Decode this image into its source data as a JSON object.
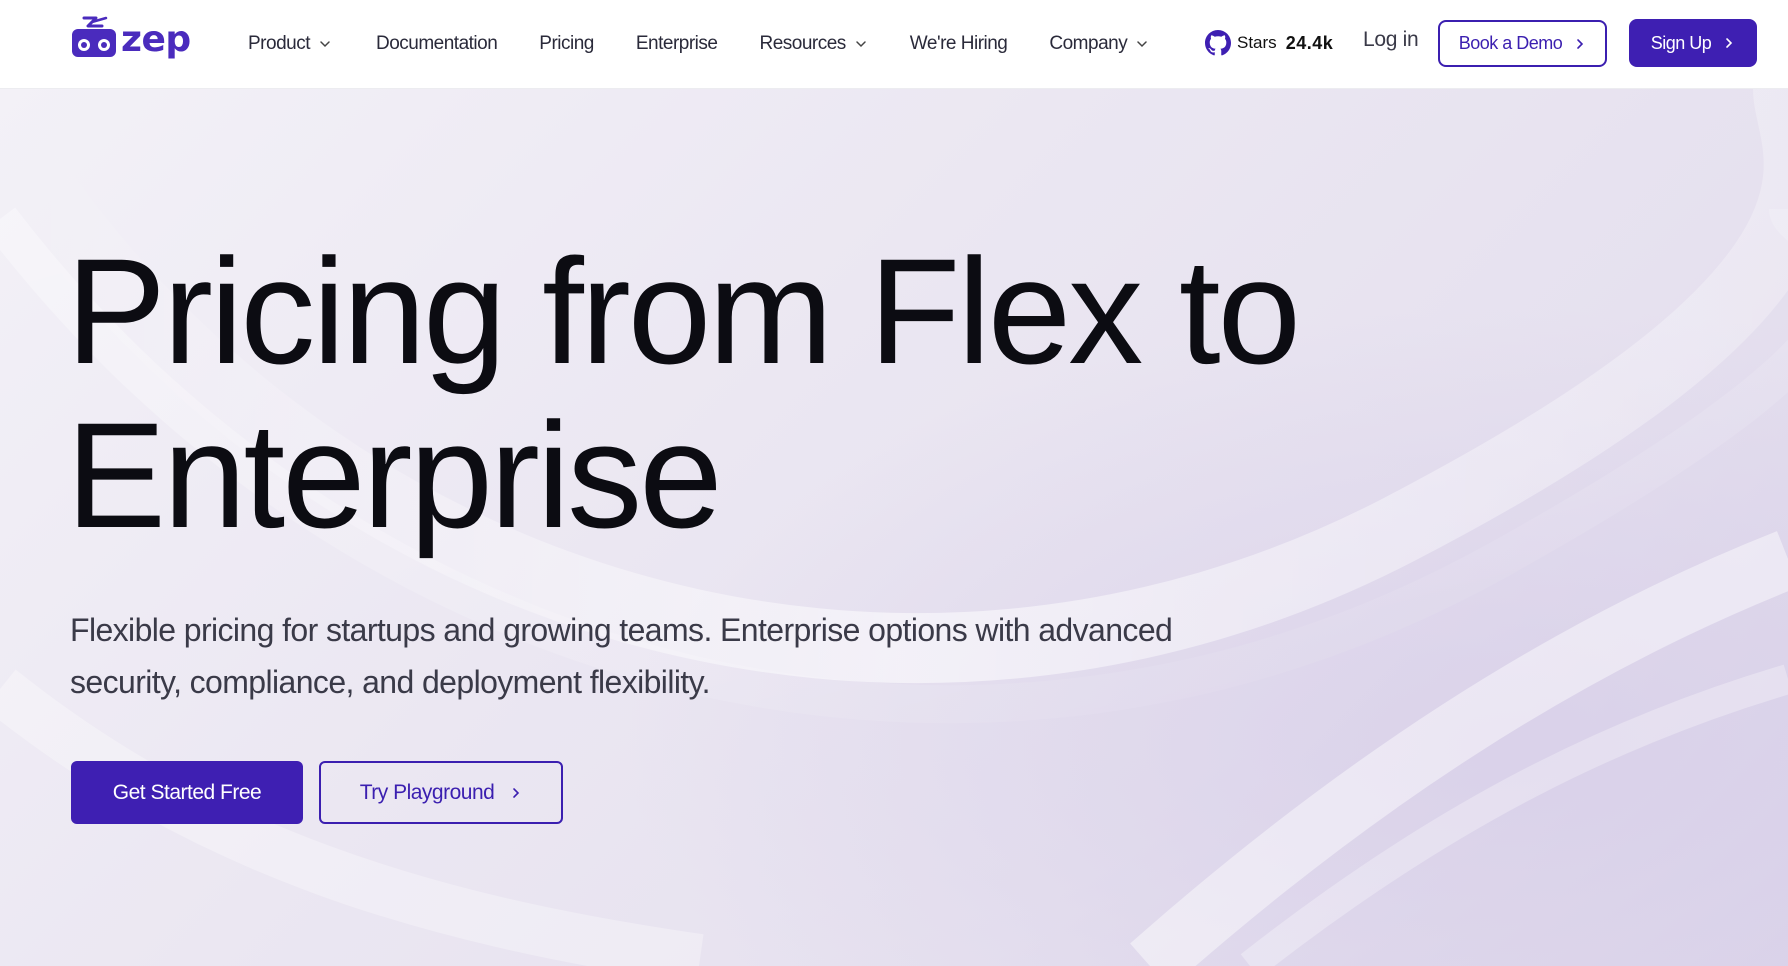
{
  "brand": {
    "name": "zep",
    "color": "#4a2bbd",
    "logo_icon": "robot-radio-logo"
  },
  "nav": {
    "items": [
      {
        "label": "Product",
        "dropdown": true
      },
      {
        "label": "Documentation",
        "dropdown": false
      },
      {
        "label": "Pricing",
        "dropdown": false
      },
      {
        "label": "Enterprise",
        "dropdown": false
      },
      {
        "label": "Resources",
        "dropdown": true
      },
      {
        "label": "We're Hiring",
        "dropdown": false
      },
      {
        "label": "Company",
        "dropdown": true
      }
    ],
    "github": {
      "icon": "github-icon",
      "label": "Stars",
      "count": "24.4k"
    },
    "login": "Log in",
    "book_demo": "Book a Demo",
    "sign_up": "Sign Up"
  },
  "hero": {
    "title_line1": "Pricing from Flex to",
    "title_line2": "Enterprise",
    "subtitle_line1": "Flexible pricing for startups and growing teams. Enterprise options with advanced",
    "subtitle_line2": "security, compliance, and deployment flexibility.",
    "cta_primary": "Get Started Free",
    "cta_secondary": "Try Playground"
  },
  "colors": {
    "accent": "#3e1fb2",
    "text": "#0c0c12",
    "background": "#ebe7f2"
  }
}
